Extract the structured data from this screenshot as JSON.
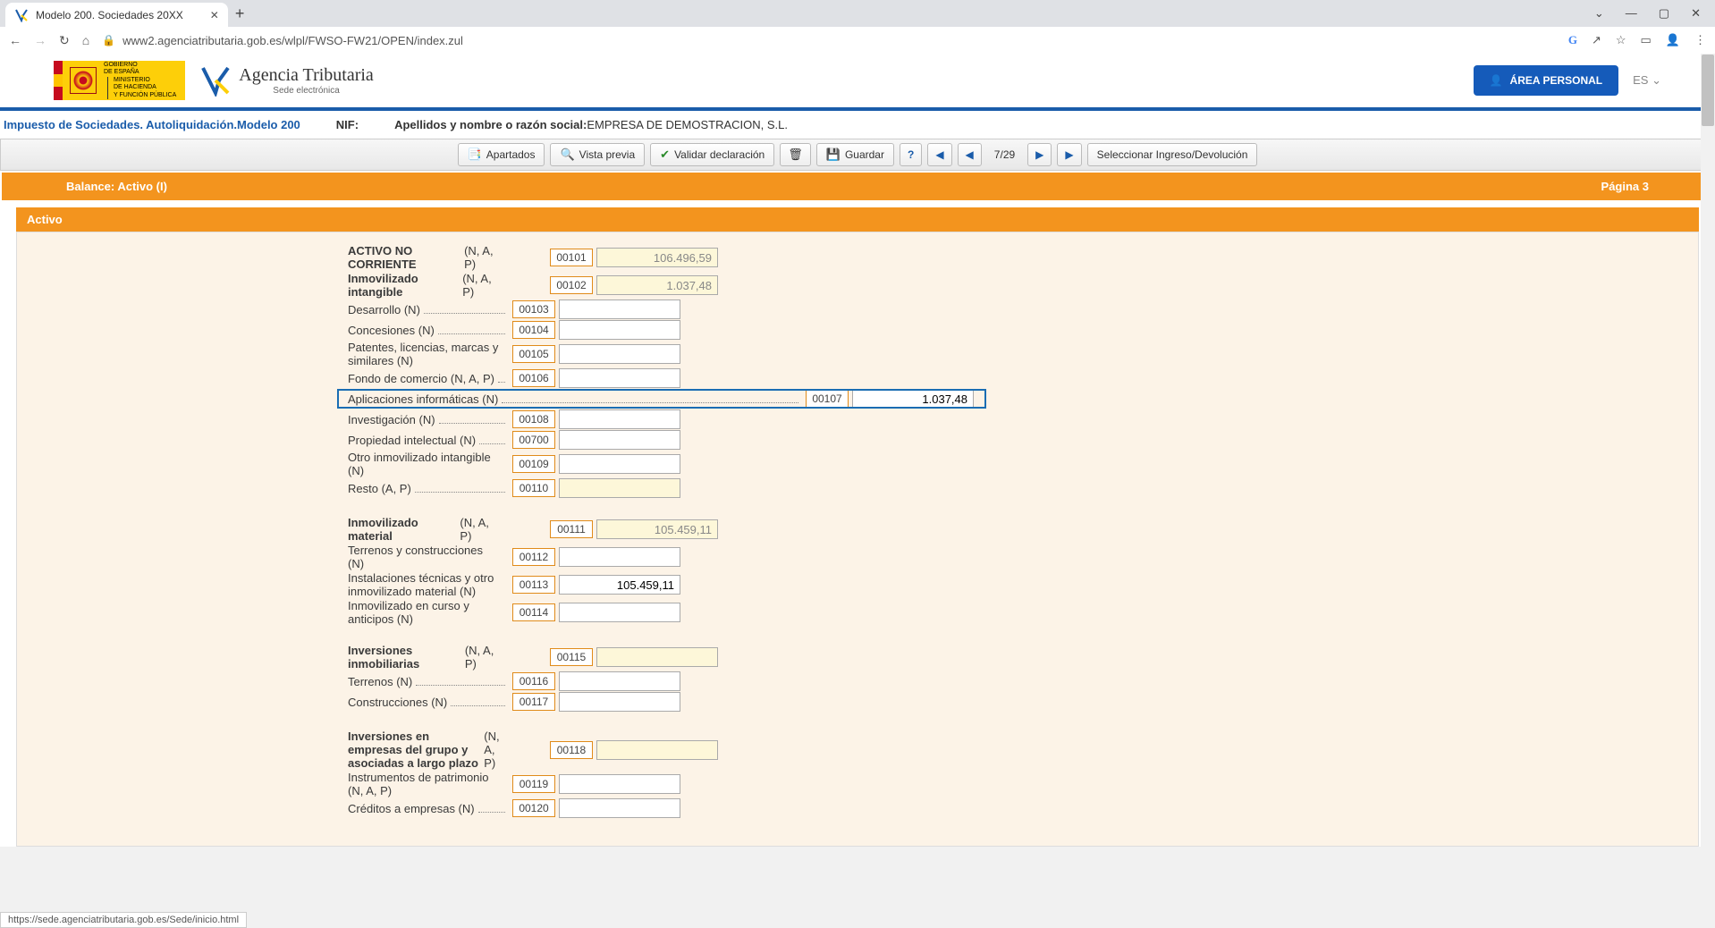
{
  "browser": {
    "tab_title": "Modelo 200. Sociedades 20XX",
    "url": "www2.agenciatributaria.gob.es/wlpl/FWSO-FW21/OPEN/index.zul",
    "status_url": "https://sede.agenciatributaria.gob.es/Sede/inicio.html"
  },
  "header": {
    "gov_line1": "GOBIERNO",
    "gov_line2": "DE ESPAÑA",
    "min_line1": "MINISTERIO",
    "min_line2": "DE HACIENDA",
    "min_line3": "Y FUNCIÓN PÚBLICA",
    "agency_main": "Agencia Tributaria",
    "agency_sub": "Sede electrónica",
    "area_personal": "ÁREA PERSONAL",
    "lang": "ES"
  },
  "form_info": {
    "title": "Impuesto de Sociedades. Autoliquidación.Modelo 200",
    "nif_label": "NIF:",
    "name_label": "Apellidos y nombre o razón social:",
    "name_value": "EMPRESA DE DEMOSTRACION, S.L."
  },
  "toolbar": {
    "apartados": "Apartados",
    "vista_previa": "Vista previa",
    "validar": "Validar declaración",
    "guardar": "Guardar",
    "page_current": "7",
    "page_total": "29",
    "ingreso": "Seleccionar Ingreso/Devolución"
  },
  "section": {
    "balance_title": "Balance: Activo (I)",
    "page_label": "Página 3",
    "activo": "Activo"
  },
  "rows": {
    "r101": {
      "label_bold": "ACTIVO NO CORRIENTE",
      "label_suffix": " (N, A, P)",
      "code": "00101",
      "value": "106.496,59"
    },
    "r102": {
      "label_bold": "Inmovilizado intangible",
      "label_suffix": " (N, A, P)",
      "code": "00102",
      "value": "1.037,48"
    },
    "r103": {
      "label": "Desarrollo (N)",
      "code": "00103",
      "value": ""
    },
    "r104": {
      "label": "Concesiones (N)",
      "code": "00104",
      "value": ""
    },
    "r105": {
      "label": "Patentes, licencias, marcas y similares (N)",
      "code": "00105",
      "value": ""
    },
    "r106": {
      "label": "Fondo de comercio (N, A, P)",
      "code": "00106",
      "value": ""
    },
    "r107": {
      "label": "Aplicaciones informáticas (N)",
      "code": "00107",
      "value": "1.037,48"
    },
    "r108": {
      "label": "Investigación (N)",
      "code": "00108",
      "value": ""
    },
    "r700": {
      "label": "Propiedad intelectual (N)",
      "code": "00700",
      "value": ""
    },
    "r109": {
      "label": "Otro inmovilizado intangible (N)",
      "code": "00109",
      "value": ""
    },
    "r110": {
      "label": "Resto (A, P)",
      "code": "00110",
      "value": ""
    },
    "r111": {
      "label_bold": "Inmovilizado material",
      "label_suffix": " (N, A, P)",
      "code": "00111",
      "value": "105.459,11"
    },
    "r112": {
      "label": "Terrenos y construcciones (N)",
      "code": "00112",
      "value": ""
    },
    "r113": {
      "label": "Instalaciones técnicas y otro inmovilizado material (N)",
      "code": "00113",
      "value": "105.459,11"
    },
    "r114": {
      "label": "Inmovilizado en curso y anticipos (N)",
      "code": "00114",
      "value": ""
    },
    "r115": {
      "label_bold": "Inversiones inmobiliarias",
      "label_suffix": " (N, A, P)",
      "code": "00115",
      "value": ""
    },
    "r116": {
      "label": "Terrenos (N)",
      "code": "00116",
      "value": ""
    },
    "r117": {
      "label": "Construcciones (N)",
      "code": "00117",
      "value": ""
    },
    "r118": {
      "label_bold": "Inversiones en empresas del grupo y asociadas a largo plazo",
      "label_suffix": " (N, A, P)",
      "code": "00118",
      "value": ""
    },
    "r119": {
      "label": "Instrumentos de patrimonio (N, A, P)",
      "code": "00119",
      "value": ""
    },
    "r120": {
      "label": "Créditos a empresas (N)",
      "code": "00120",
      "value": ""
    }
  }
}
